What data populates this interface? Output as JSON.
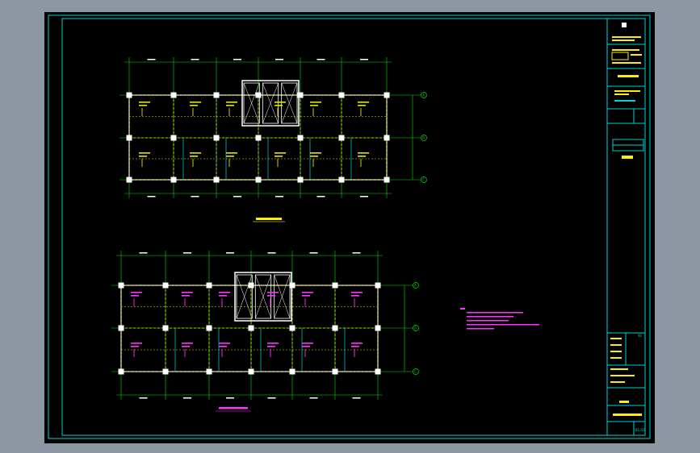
{
  "drawing": {
    "background": "#000000",
    "frame_color": "#00d4d4",
    "wall_color": "#ffffff",
    "grid_color": "#00e000",
    "beam_color": "#e6e600",
    "rebar_color": "#ff33ff",
    "title_block": {
      "side_note": "XX",
      "sheet_label": "01/01"
    }
  },
  "plans": [
    {
      "id": "upper-plan",
      "grid_bubbles_right": [
        "A",
        "B",
        "C"
      ]
    },
    {
      "id": "lower-plan",
      "grid_bubbles_right": [
        "A",
        "B",
        "C"
      ]
    }
  ]
}
